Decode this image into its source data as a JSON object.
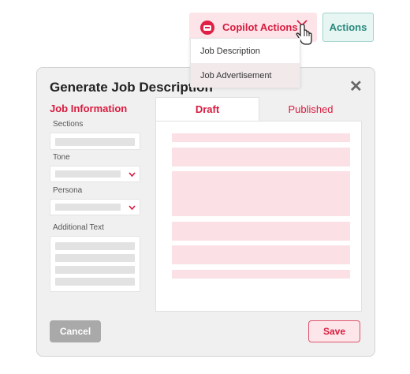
{
  "copilot": {
    "label": "Copilot Actions",
    "icon": "copilot-bot-icon"
  },
  "actions": {
    "label": "Actions"
  },
  "menu": {
    "items": [
      "Job Description",
      "Job Advertisement"
    ],
    "hovered": 1
  },
  "dialog": {
    "title": "Generate Job Description",
    "close_icon": "close-icon",
    "section_title": "Job Information",
    "fields": {
      "sections": "Sections",
      "tone": "Tone",
      "persona": "Persona",
      "additional_text": "Additional Text"
    },
    "tabs": [
      "Draft",
      "Published"
    ],
    "active_tab": "Draft",
    "cancel": "Cancel",
    "save": "Save"
  },
  "colors": {
    "accent": "#d81b3f",
    "pink_fill": "#fbe1e5",
    "teal": "#2a8a7d"
  }
}
